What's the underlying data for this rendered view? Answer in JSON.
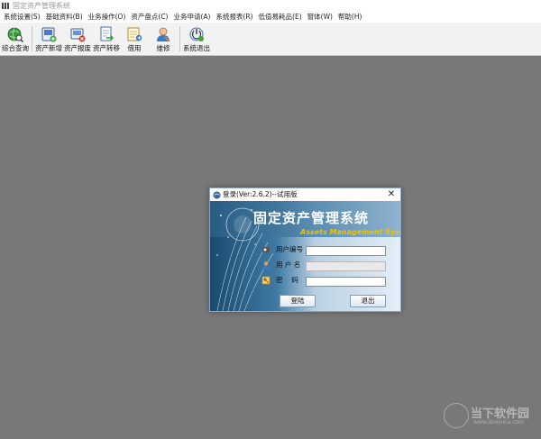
{
  "window": {
    "title": "固定资产管理系统"
  },
  "menu": [
    "系统设置(S)",
    "基础资料(B)",
    "业务操作(O)",
    "资产盘点(C)",
    "业务申请(A)",
    "系统报表(R)",
    "低值易耗品(E)",
    "窗体(W)",
    "帮助(H)"
  ],
  "toolbar": [
    {
      "label": "综合查询",
      "icon": "search-globe-icon"
    },
    {
      "label": "资产新增",
      "icon": "asset-add-icon"
    },
    {
      "label": "资产报废",
      "icon": "asset-scrap-icon"
    },
    {
      "label": "资产转移",
      "icon": "asset-transfer-icon"
    },
    {
      "label": "借用",
      "icon": "borrow-icon"
    },
    {
      "label": "维修",
      "icon": "repair-icon"
    },
    {
      "label": "系统退出",
      "icon": "exit-icon"
    }
  ],
  "login": {
    "title": "登录(Ver:2.6.2)--试用版",
    "banner_title": "固定资产管理系统",
    "banner_subtitle": "Assets Management System",
    "fields": [
      {
        "label": "用户编号",
        "value": "",
        "icon": "user-id-icon"
      },
      {
        "label": "用 户 名",
        "value": "",
        "icon": "user-icon"
      },
      {
        "label": "密　 码",
        "value": "",
        "icon": "key-icon"
      }
    ],
    "login_button": "登陆",
    "exit_button": "退出",
    "colors": {
      "banner_dark": "#1f4e72",
      "banner_light": "#dce8f2",
      "subtitle": "#f2c200"
    }
  },
  "watermark": {
    "text": "当下软件园",
    "url": "www.downxia.com"
  }
}
